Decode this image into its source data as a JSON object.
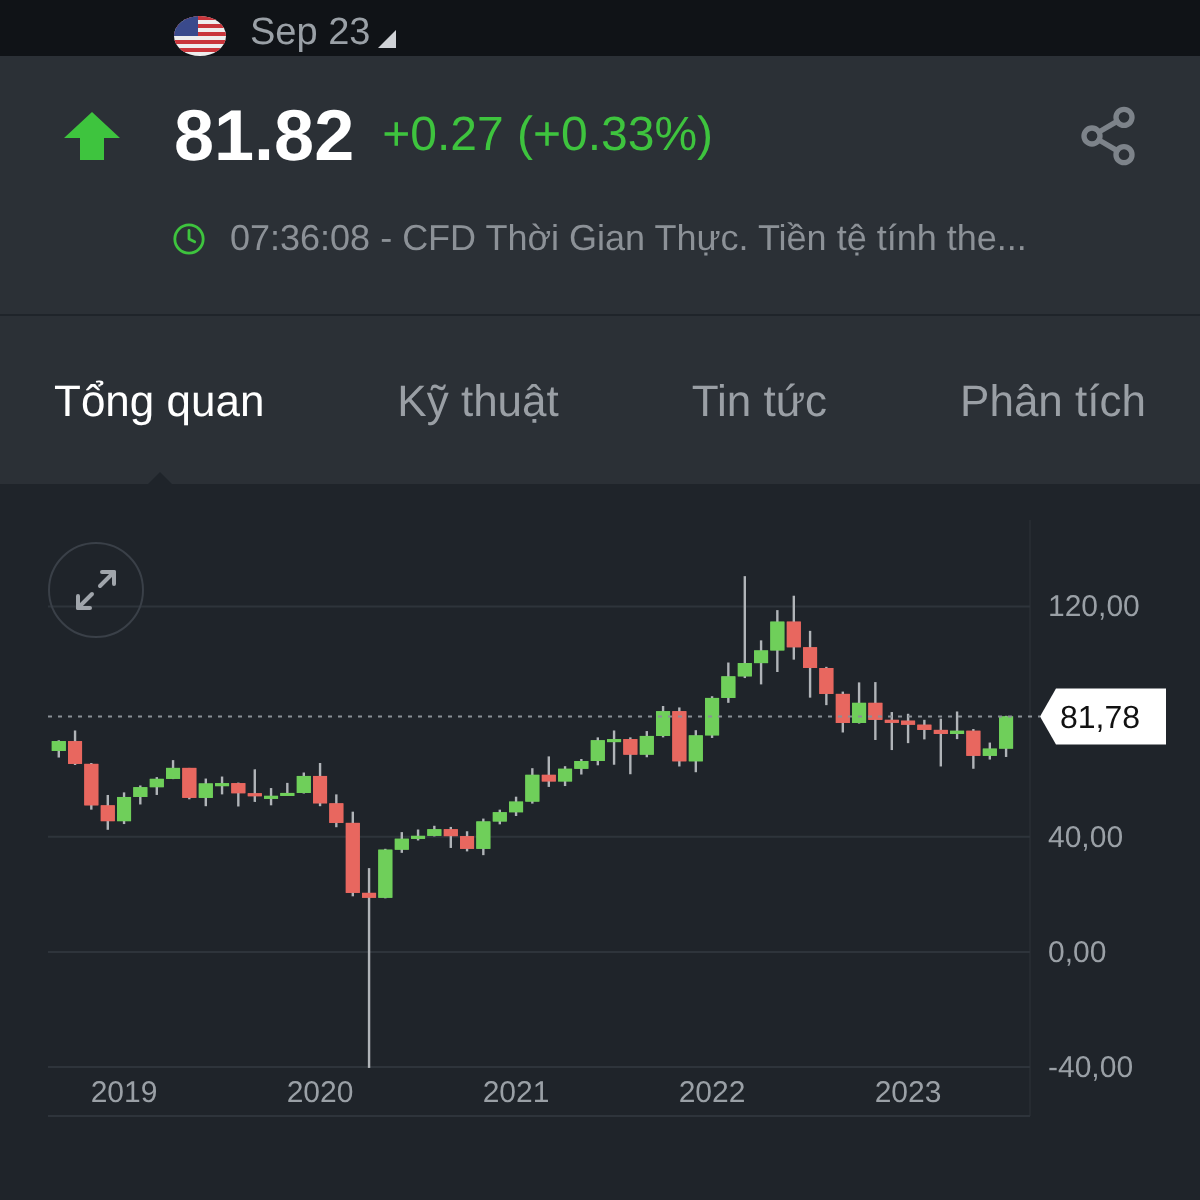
{
  "top_bar": {
    "contract": "Sep 23"
  },
  "quote": {
    "price": "81.82",
    "change": "+0.27 (+0.33%)",
    "info": "07:36:08 - CFD Thời Gian Thực. Tiền tệ tính the..."
  },
  "tabs": [
    {
      "label": "Tổng quan",
      "selected": true
    },
    {
      "label": "Kỹ thuật",
      "selected": false
    },
    {
      "label": "Tin tức",
      "selected": false
    },
    {
      "label": "Phân tích",
      "selected": false
    }
  ],
  "chart": {
    "chart_data": {
      "type": "candlestick",
      "ylim": [
        -57,
        150
      ],
      "yticks": [
        {
          "value": 120,
          "label": "120,00"
        },
        {
          "value": 40,
          "label": "40,00"
        },
        {
          "value": 0,
          "label": "0,00"
        },
        {
          "value": -40,
          "label": "-40,00"
        }
      ],
      "xticks": [
        2019,
        2020,
        2021,
        2022,
        2023
      ],
      "xlim": [
        2018.612,
        2023.622
      ],
      "grid": true,
      "ref_lines": [
        {
          "axis": "y",
          "value": 81.78,
          "label": "81,78",
          "color": "#8a9096"
        }
      ],
      "x": [
        2018.667,
        2018.75,
        2018.833,
        2018.917,
        2019,
        2019.083,
        2019.167,
        2019.25,
        2019.333,
        2019.417,
        2019.5,
        2019.583,
        2019.667,
        2019.75,
        2019.833,
        2019.917,
        2020,
        2020.083,
        2020.167,
        2020.25,
        2020.333,
        2020.417,
        2020.5,
        2020.583,
        2020.667,
        2020.75,
        2020.833,
        2020.917,
        2021,
        2021.083,
        2021.167,
        2021.25,
        2021.333,
        2021.417,
        2021.5,
        2021.583,
        2021.667,
        2021.75,
        2021.833,
        2021.917,
        2022,
        2022.083,
        2022.167,
        2022.25,
        2022.333,
        2022.417,
        2022.5,
        2022.583,
        2022.667,
        2022.75,
        2022.833,
        2022.917,
        2023,
        2023.083,
        2023.167,
        2023.25,
        2023.333,
        2023.417,
        2023.5
      ],
      "ohlc": [
        [
          69.8,
          73.5,
          67.5,
          73.2
        ],
        [
          73.2,
          76.9,
          64.9,
          65.3
        ],
        [
          65.3,
          65.6,
          49.4,
          50.9
        ],
        [
          50.9,
          54.5,
          42.4,
          45.4
        ],
        [
          45.4,
          55.4,
          44.4,
          53.8
        ],
        [
          53.8,
          57.8,
          51.2,
          57.2
        ],
        [
          57.2,
          60.7,
          54.5,
          60.1
        ],
        [
          60.1,
          66.6,
          60.0,
          63.9
        ],
        [
          63.9,
          63.9,
          53.0,
          53.5
        ],
        [
          53.5,
          60.2,
          50.6,
          58.5
        ],
        [
          58.5,
          60.9,
          54.7,
          58.6
        ],
        [
          58.6,
          58.8,
          50.5,
          55.1
        ],
        [
          55.1,
          63.4,
          52.1,
          54.1
        ],
        [
          54.1,
          56.9,
          50.9,
          54.2
        ],
        [
          54.2,
          58.7,
          54.2,
          55.2
        ],
        [
          55.2,
          62.3,
          55.0,
          61.1
        ],
        [
          61.1,
          65.6,
          50.6,
          51.6
        ],
        [
          51.6,
          54.7,
          43.3,
          44.8
        ],
        [
          44.8,
          48.7,
          19.3,
          20.5
        ],
        [
          20.5,
          29.1,
          -40.3,
          18.8
        ],
        [
          18.8,
          35.8,
          18.6,
          35.5
        ],
        [
          35.5,
          41.6,
          34.4,
          39.3
        ],
        [
          39.3,
          42.5,
          38.7,
          40.3
        ],
        [
          40.3,
          43.8,
          40.1,
          42.6
        ],
        [
          42.6,
          43.4,
          36.1,
          40.2
        ],
        [
          40.2,
          41.9,
          34.9,
          35.8
        ],
        [
          35.8,
          46.3,
          33.6,
          45.3
        ],
        [
          45.3,
          49.4,
          44.3,
          48.5
        ],
        [
          48.5,
          53.9,
          47.2,
          52.2
        ],
        [
          52.2,
          63.8,
          51.5,
          61.5
        ],
        [
          61.5,
          67.9,
          57.3,
          59.2
        ],
        [
          59.2,
          64.5,
          57.6,
          63.6
        ],
        [
          63.6,
          67.0,
          61.6,
          66.3
        ],
        [
          66.3,
          74.5,
          64.8,
          73.5
        ],
        [
          73.5,
          76.9,
          65.0,
          73.9
        ],
        [
          73.9,
          74.5,
          61.7,
          68.5
        ],
        [
          68.5,
          76.7,
          67.6,
          75.0
        ],
        [
          75.0,
          85.4,
          74.5,
          83.6
        ],
        [
          83.6,
          84.9,
          64.4,
          66.2
        ],
        [
          66.2,
          77.0,
          62.4,
          75.2
        ],
        [
          75.2,
          88.8,
          74.3,
          88.2
        ],
        [
          88.2,
          100.5,
          86.5,
          95.7
        ],
        [
          95.7,
          130.5,
          95.1,
          100.3
        ],
        [
          100.3,
          108.2,
          92.9,
          104.7
        ],
        [
          104.7,
          118.7,
          97.2,
          114.7
        ],
        [
          114.7,
          123.7,
          101.5,
          105.8
        ],
        [
          105.8,
          111.5,
          88.3,
          98.6
        ],
        [
          98.6,
          99.0,
          85.7,
          89.6
        ],
        [
          89.6,
          90.4,
          76.2,
          79.5
        ],
        [
          79.5,
          93.6,
          79.3,
          86.5
        ],
        [
          86.5,
          93.7,
          73.6,
          80.6
        ],
        [
          80.6,
          83.3,
          70.1,
          80.3
        ],
        [
          80.3,
          82.7,
          72.5,
          78.9
        ],
        [
          78.9,
          80.6,
          73.8,
          77.1
        ],
        [
          77.1,
          81.0,
          64.4,
          75.7
        ],
        [
          75.7,
          83.5,
          73.9,
          76.8
        ],
        [
          76.8,
          77.4,
          63.6,
          68.1
        ],
        [
          68.1,
          72.7,
          66.8,
          70.6
        ],
        [
          70.6,
          82.0,
          67.7,
          81.8
        ]
      ]
    }
  }
}
